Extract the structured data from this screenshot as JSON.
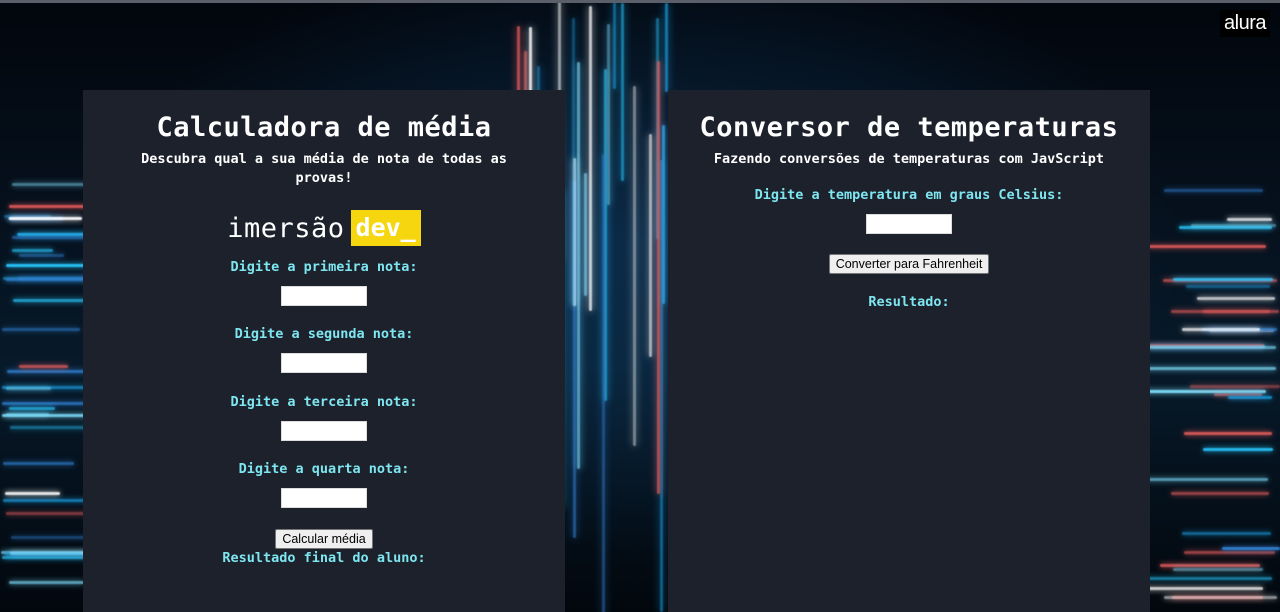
{
  "brand": {
    "logo_text": "alura"
  },
  "colors": {
    "panel_bg": "#1c212b",
    "label_accent": "#7ee6f0",
    "dev_badge": "#f5d60f"
  },
  "left_panel": {
    "title": "Calculadora de média",
    "subtitle": "Descubra qual a sua média de nota de todas as provas!",
    "brand_word": "imersão",
    "brand_badge": "dev_",
    "fields": [
      {
        "label": "Digite a primeira nota:",
        "value": ""
      },
      {
        "label": "Digite a segunda nota:",
        "value": ""
      },
      {
        "label": "Digite a terceira nota:",
        "value": ""
      },
      {
        "label": "Digite a quarta nota:",
        "value": ""
      }
    ],
    "button_label": "Calcular média",
    "result_label": "Resultado final do aluno:"
  },
  "right_panel": {
    "title": "Conversor de temperaturas",
    "subtitle": "Fazendo conversões de temperaturas com JavScript",
    "field_label": "Digite a temperatura em graus Celsius:",
    "field_value": "",
    "button_label": "Converter para Fahrenheit",
    "result_label": "Resultado:"
  }
}
